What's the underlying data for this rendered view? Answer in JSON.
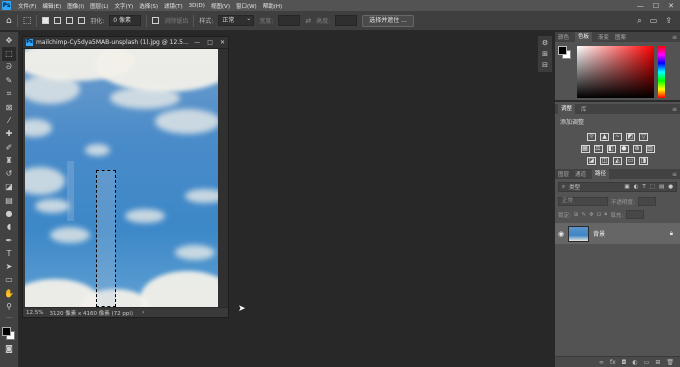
{
  "menubar": {
    "logo": "Ps",
    "items": [
      "文件(F)",
      "编辑(E)",
      "图像(I)",
      "图层(L)",
      "文字(Y)",
      "选择(S)",
      "滤镜(T)",
      "3D(D)",
      "视图(V)",
      "窗口(W)",
      "帮助(H)"
    ]
  },
  "options": {
    "feather_label": "羽化:",
    "feather_value": "0 像素",
    "antialias_label": "消除锯齿",
    "style_label": "样式:",
    "style_value": "正常",
    "width_label": "宽度:",
    "height_label": "高度:",
    "select_mask_button": "选择并遮住 ..."
  },
  "document": {
    "title": "mailchimp-Cy5dya5MAB-unsplash (1).jpg @ 12.5...",
    "zoom": "12.5%",
    "dimensions": "3120 像素 x 4160 像素 (72 ppi)"
  },
  "panels": {
    "color_tabs": [
      "颜色",
      "色板",
      "渐变",
      "图案"
    ],
    "adjust_tabs": [
      "调整",
      "库"
    ],
    "adjust_title": "添加调整",
    "layers_tabs": [
      "图层",
      "通道",
      "路径"
    ],
    "layers_kind": "类型",
    "blend_mode": "正常",
    "opacity_label": "不透明度:",
    "lock_label": "锁定:",
    "fill_label": "填充:",
    "layer_name": "背景"
  },
  "colors": {
    "accent": "#31a8ff",
    "foreground": "#000000",
    "background": "#ffffff"
  }
}
